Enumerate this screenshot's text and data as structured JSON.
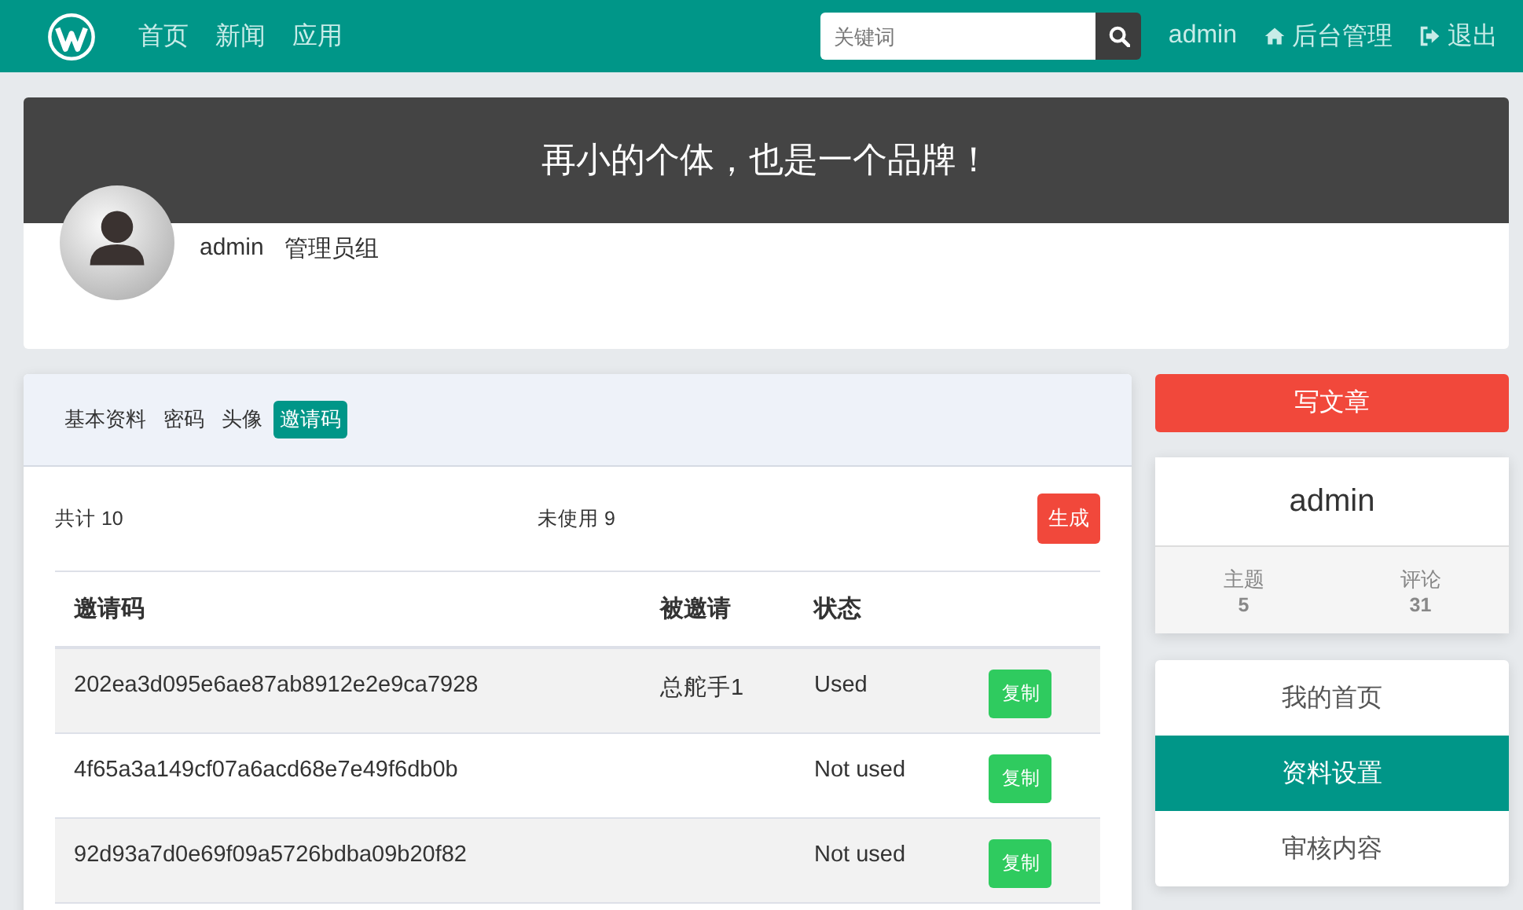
{
  "navbar": {
    "links": [
      "首页",
      "新闻",
      "应用"
    ],
    "search": {
      "placeholder": "关键词"
    },
    "user": "admin",
    "admin_link": "后台管理",
    "logout": "退出"
  },
  "banner": {
    "slogan": "再小的个体，也是一个品牌！",
    "username": "admin",
    "group": "管理员组"
  },
  "tabs": [
    {
      "label": "基本资料",
      "selected": false
    },
    {
      "label": "密码",
      "selected": false
    },
    {
      "label": "头像",
      "selected": false
    },
    {
      "label": "邀请码",
      "selected": true
    }
  ],
  "summary": {
    "total": "共计 10",
    "unused": "未使用 9",
    "generate_button": "生成"
  },
  "table": {
    "columns": [
      "邀请码",
      "被邀请",
      "状态"
    ],
    "rows": [
      {
        "code": "202ea3d095e6ae87ab8912e2e9ca7928",
        "invitee": "总舵手1",
        "status": "Used",
        "action": "复制"
      },
      {
        "code": "4f65a3a149cf07a6acd68e7e49f6db0b",
        "status": "Not used",
        "action": "复制"
      },
      {
        "code": "92d93a7d0e69f09a5726bdba09b20f82",
        "status": "Not used",
        "action": "复制"
      }
    ]
  },
  "sidebar": {
    "write_button": "写文章",
    "profile": {
      "name": "admin",
      "stats": [
        {
          "label": "主题",
          "value": "5"
        },
        {
          "label": "评论",
          "value": "31"
        }
      ]
    },
    "menu": [
      {
        "label": "我的首页",
        "selected": false
      },
      {
        "label": "资料设置",
        "selected": true
      },
      {
        "label": "审核内容",
        "selected": false
      }
    ]
  }
}
